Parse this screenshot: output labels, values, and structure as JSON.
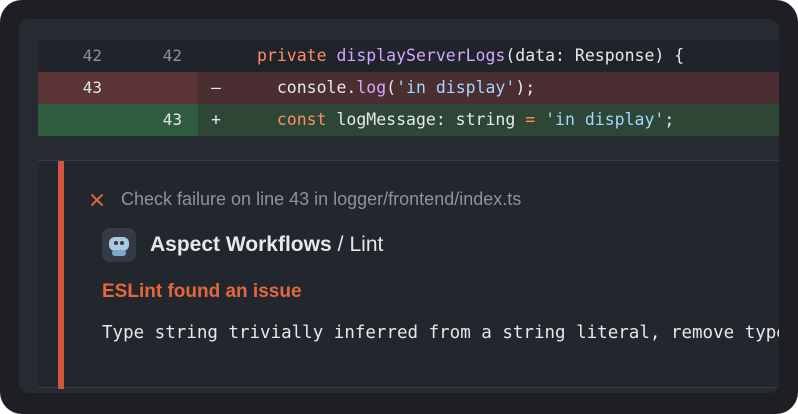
{
  "diff": {
    "rows": [
      {
        "type": "context",
        "old_line": "42",
        "new_line": "42",
        "marker": "",
        "code_parts": [
          "private",
          " ",
          "displayServerLogs",
          "(data: Response) {"
        ]
      },
      {
        "type": "del",
        "old_line": "43",
        "new_line": "",
        "marker": "–",
        "code_parts": [
          "  console.",
          "log",
          "(",
          "'in display'",
          ");"
        ]
      },
      {
        "type": "add",
        "old_line": "",
        "new_line": "43",
        "marker": "+",
        "code_parts": [
          "  ",
          "const",
          " logMessage: string ",
          "=",
          " ",
          "'in display'",
          ";"
        ]
      }
    ]
  },
  "annotation": {
    "check_failure": "Check failure on line 43 in logger/frontend/index.ts",
    "app_name": "Aspect Workflows",
    "separator": "/",
    "check_name": "Lint",
    "title": "ESLint found an issue",
    "message": "Type string trivially inferred from a string literal, remove type annotation."
  },
  "colors": {
    "accent_error": "#e5673e",
    "del_bg": "#4a2e31",
    "add_bg": "#2d4636"
  },
  "icons": {
    "failure": "x-icon",
    "app": "bot-avatar-icon"
  }
}
